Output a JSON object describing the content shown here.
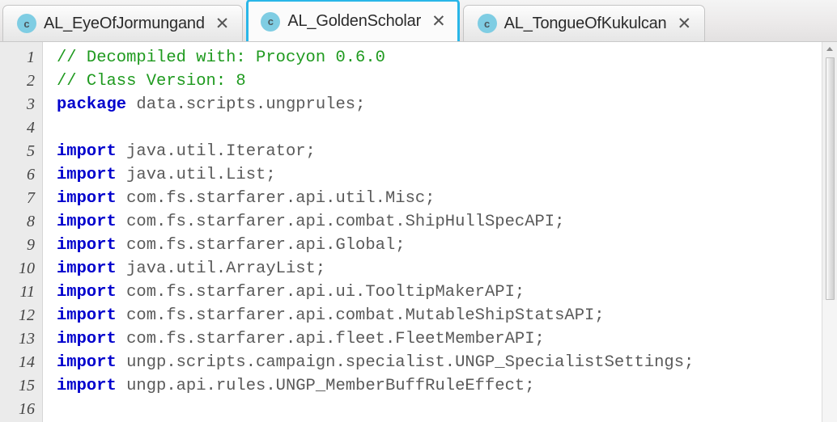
{
  "tabs": [
    {
      "icon_letter": "c",
      "label": "AL_EyeOfJormungand",
      "close": "✕",
      "active": false
    },
    {
      "icon_letter": "c",
      "label": "AL_GoldenScholar",
      "close": "✕",
      "active": true
    },
    {
      "icon_letter": "c",
      "label": "AL_TongueOfKukulcan",
      "close": "✕",
      "active": false
    }
  ],
  "editor": {
    "line_numbers": [
      "1",
      "2",
      "3",
      "4",
      "5",
      "6",
      "7",
      "8",
      "9",
      "10",
      "11",
      "12",
      "13",
      "14",
      "15",
      "16"
    ],
    "lines": [
      {
        "n": "1",
        "keyword": "",
        "comment": "// Decompiled with: Procyon 0.6.0",
        "rest": ""
      },
      {
        "n": "2",
        "keyword": "",
        "comment": "// Class Version: 8",
        "rest": ""
      },
      {
        "n": "3",
        "keyword": "package",
        "comment": "",
        "rest": " data.scripts.ungprules;"
      },
      {
        "n": "4",
        "keyword": "",
        "comment": "",
        "rest": ""
      },
      {
        "n": "5",
        "keyword": "import",
        "comment": "",
        "rest": " java.util.Iterator;"
      },
      {
        "n": "6",
        "keyword": "import",
        "comment": "",
        "rest": " java.util.List;"
      },
      {
        "n": "7",
        "keyword": "import",
        "comment": "",
        "rest": " com.fs.starfarer.api.util.Misc;"
      },
      {
        "n": "8",
        "keyword": "import",
        "comment": "",
        "rest": " com.fs.starfarer.api.combat.ShipHullSpecAPI;"
      },
      {
        "n": "9",
        "keyword": "import",
        "comment": "",
        "rest": " com.fs.starfarer.api.Global;"
      },
      {
        "n": "10",
        "keyword": "import",
        "comment": "",
        "rest": " java.util.ArrayList;"
      },
      {
        "n": "11",
        "keyword": "import",
        "comment": "",
        "rest": " com.fs.starfarer.api.ui.TooltipMakerAPI;"
      },
      {
        "n": "12",
        "keyword": "import",
        "comment": "",
        "rest": " com.fs.starfarer.api.combat.MutableShipStatsAPI;"
      },
      {
        "n": "13",
        "keyword": "import",
        "comment": "",
        "rest": " com.fs.starfarer.api.fleet.FleetMemberAPI;"
      },
      {
        "n": "14",
        "keyword": "import",
        "comment": "",
        "rest": " ungp.scripts.campaign.specialist.UNGP_SpecialistSettings;"
      },
      {
        "n": "15",
        "keyword": "import",
        "comment": "",
        "rest": " ungp.api.rules.UNGP_MemberBuffRuleEffect;"
      },
      {
        "n": "16",
        "keyword": "",
        "comment": "",
        "rest": ""
      }
    ]
  },
  "colors": {
    "accent_active_tab": "#29b6e8",
    "icon_circle": "#7fcde3",
    "comment": "#1f9a1f",
    "keyword": "#0000cd",
    "identifier": "#5a5a5a",
    "gutter_bg": "#ebebeb",
    "editor_bg": "#ffffff"
  }
}
